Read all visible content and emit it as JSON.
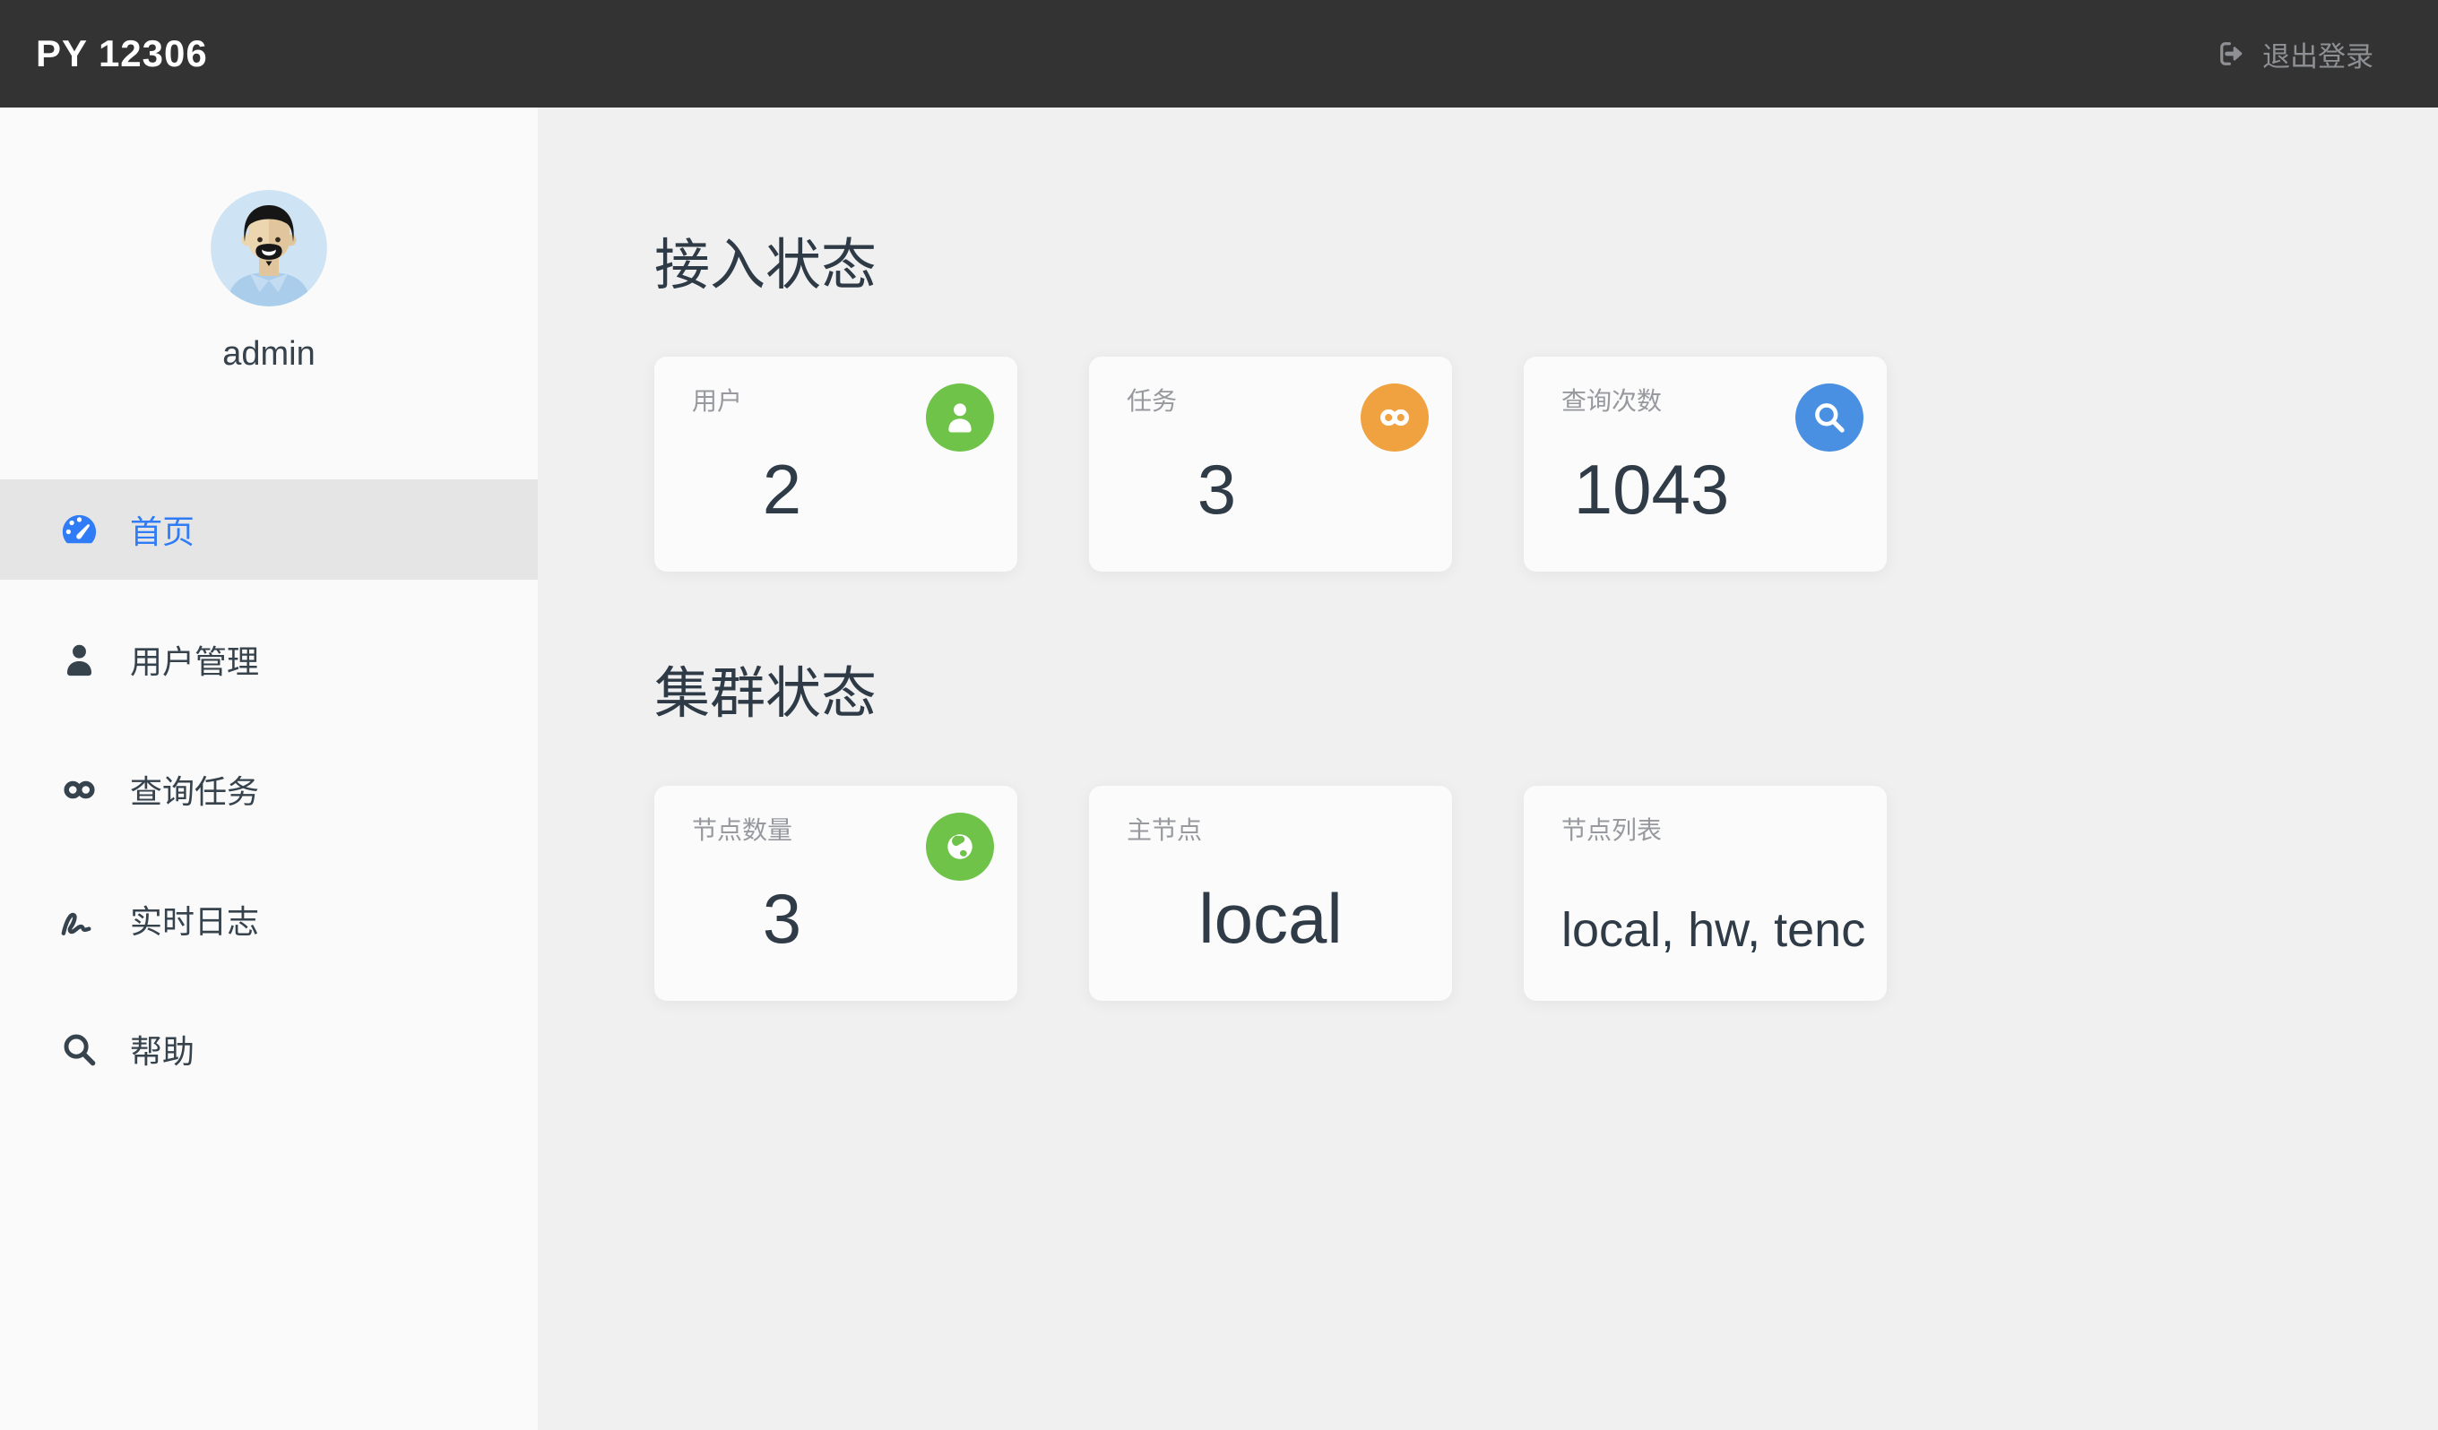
{
  "topbar": {
    "title": "PY 12306",
    "logout_label": "退出登录"
  },
  "sidebar": {
    "username": "admin",
    "menu": [
      {
        "label": "首页",
        "icon": "dashboard-icon",
        "active": true
      },
      {
        "label": "用户管理",
        "icon": "user-icon",
        "active": false
      },
      {
        "label": "查询任务",
        "icon": "infinity-icon",
        "active": false
      },
      {
        "label": "实时日志",
        "icon": "signature-icon",
        "active": false
      },
      {
        "label": "帮助",
        "icon": "search-icon",
        "active": false
      }
    ]
  },
  "main": {
    "sections": [
      {
        "title": "接入状态",
        "cards": [
          {
            "label": "用户",
            "value": "2",
            "icon": "user-icon",
            "icon_color": "#6ec348"
          },
          {
            "label": "任务",
            "value": "3",
            "icon": "infinity-icon",
            "icon_color": "#efa23f"
          },
          {
            "label": "查询次数",
            "value": "1043",
            "icon": "search-icon",
            "icon_color": "#4a90e2"
          }
        ]
      },
      {
        "title": "集群状态",
        "cards": [
          {
            "label": "节点数量",
            "value": "3",
            "icon": "globe-icon",
            "icon_color": "#6ec348"
          },
          {
            "label": "主节点",
            "value": "local"
          },
          {
            "label": "节点列表",
            "value": "local, hw, tenc"
          }
        ]
      }
    ]
  },
  "colors": {
    "topbar_bg": "#333333",
    "sidebar_bg": "#fafafa",
    "sidebar_active_bg": "#e5e5e6",
    "main_bg": "#f0f0f1",
    "card_bg": "#fbfbfb",
    "accent_blue": "#2f7cf6",
    "icon_green": "#6ec348",
    "icon_orange": "#efa23f",
    "icon_blue": "#4a90e2",
    "text_dark": "#2f3b46",
    "text_muted": "#97999e",
    "logout_gray": "#8e9094"
  }
}
